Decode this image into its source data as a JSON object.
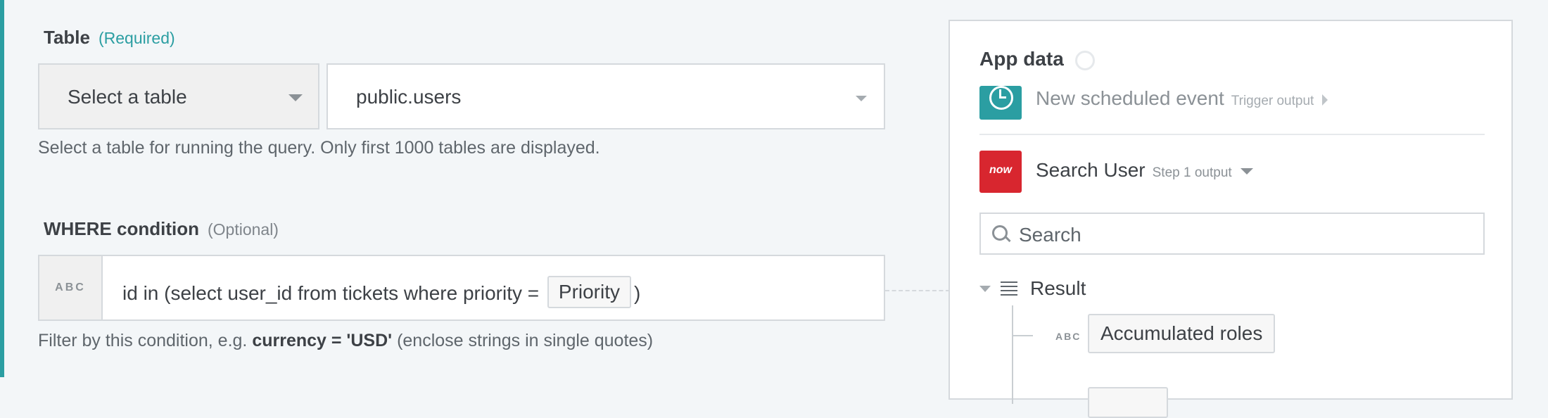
{
  "table_field": {
    "label": "Table",
    "required_tag": "(Required)",
    "type_select_value": "Select a table",
    "table_select_value": "public.users",
    "help_text": "Select a table for running the query. Only first 1000 tables are displayed."
  },
  "where_field": {
    "label": "WHERE condition",
    "optional_tag": "(Optional)",
    "type_badge": "ABC",
    "query_prefix": "id in (select user_id from tickets where priority =",
    "query_pill": "Priority",
    "query_suffix": ")",
    "help_prefix": "Filter by this condition, e.g.",
    "help_example": "currency = 'USD'",
    "help_suffix": "(enclose strings in single quotes)"
  },
  "app_data": {
    "title": "App data",
    "trigger": {
      "name": "New scheduled event",
      "sub": "Trigger output",
      "icon": "clock-icon"
    },
    "step": {
      "name": "Search User",
      "sub": "Step 1 output",
      "icon_text": "now"
    },
    "search_placeholder": "Search",
    "tree": {
      "root_label": "Result",
      "children": [
        {
          "type_badge": "ABC",
          "label": "Accumulated roles"
        }
      ]
    }
  },
  "colors": {
    "accent": "#2b9ea2",
    "servicenow_red": "#d8262f",
    "background": "#f3f6f8"
  }
}
